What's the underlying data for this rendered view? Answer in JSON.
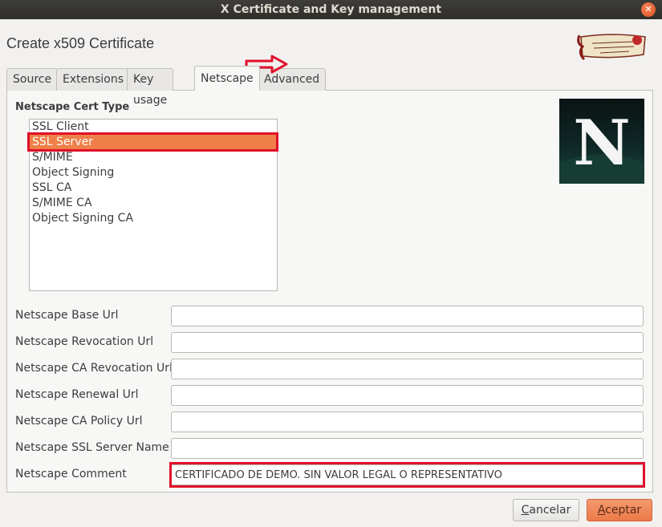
{
  "window": {
    "title": "X Certificate and Key management",
    "close_glyph": "✕"
  },
  "dialog": {
    "title": "Create x509 Certificate"
  },
  "tabs": [
    {
      "label": "Source"
    },
    {
      "label": "Extensions"
    },
    {
      "label": "Key usage"
    },
    {
      "label": "Netscape",
      "active": true
    },
    {
      "label": "Advanced"
    }
  ],
  "netscape": {
    "cert_type_label": "Netscape Cert Type",
    "cert_types": [
      {
        "label": "SSL Client"
      },
      {
        "label": "SSL Server",
        "selected": true
      },
      {
        "label": "S/MIME"
      },
      {
        "label": "Object Signing"
      },
      {
        "label": "SSL CA"
      },
      {
        "label": "S/MIME CA"
      },
      {
        "label": "Object Signing CA"
      }
    ],
    "logo_letter": "N",
    "fields": [
      {
        "label": "Netscape Base Url",
        "value": ""
      },
      {
        "label": "Netscape Revocation Url",
        "value": ""
      },
      {
        "label": "Netscape CA Revocation Url",
        "value": ""
      },
      {
        "label": "Netscape Renewal Url",
        "value": ""
      },
      {
        "label": "Netscape CA Policy Url",
        "value": ""
      },
      {
        "label": "Netscape SSL Server Name",
        "value": ""
      },
      {
        "label": "Netscape Comment",
        "value": "CERTIFICADO DE DEMO. SIN VALOR LEGAL O REPRESENTATIVO"
      }
    ]
  },
  "buttons": {
    "cancel_label_mnemonic": "C",
    "cancel_label_rest": "ancelar",
    "ok_label_mnemonic": "A",
    "ok_label_rest": "ceptar"
  },
  "colors": {
    "accent": "#ef7f48",
    "annotation_red": "#e0102a",
    "titlebar": "#2f2e2b"
  }
}
